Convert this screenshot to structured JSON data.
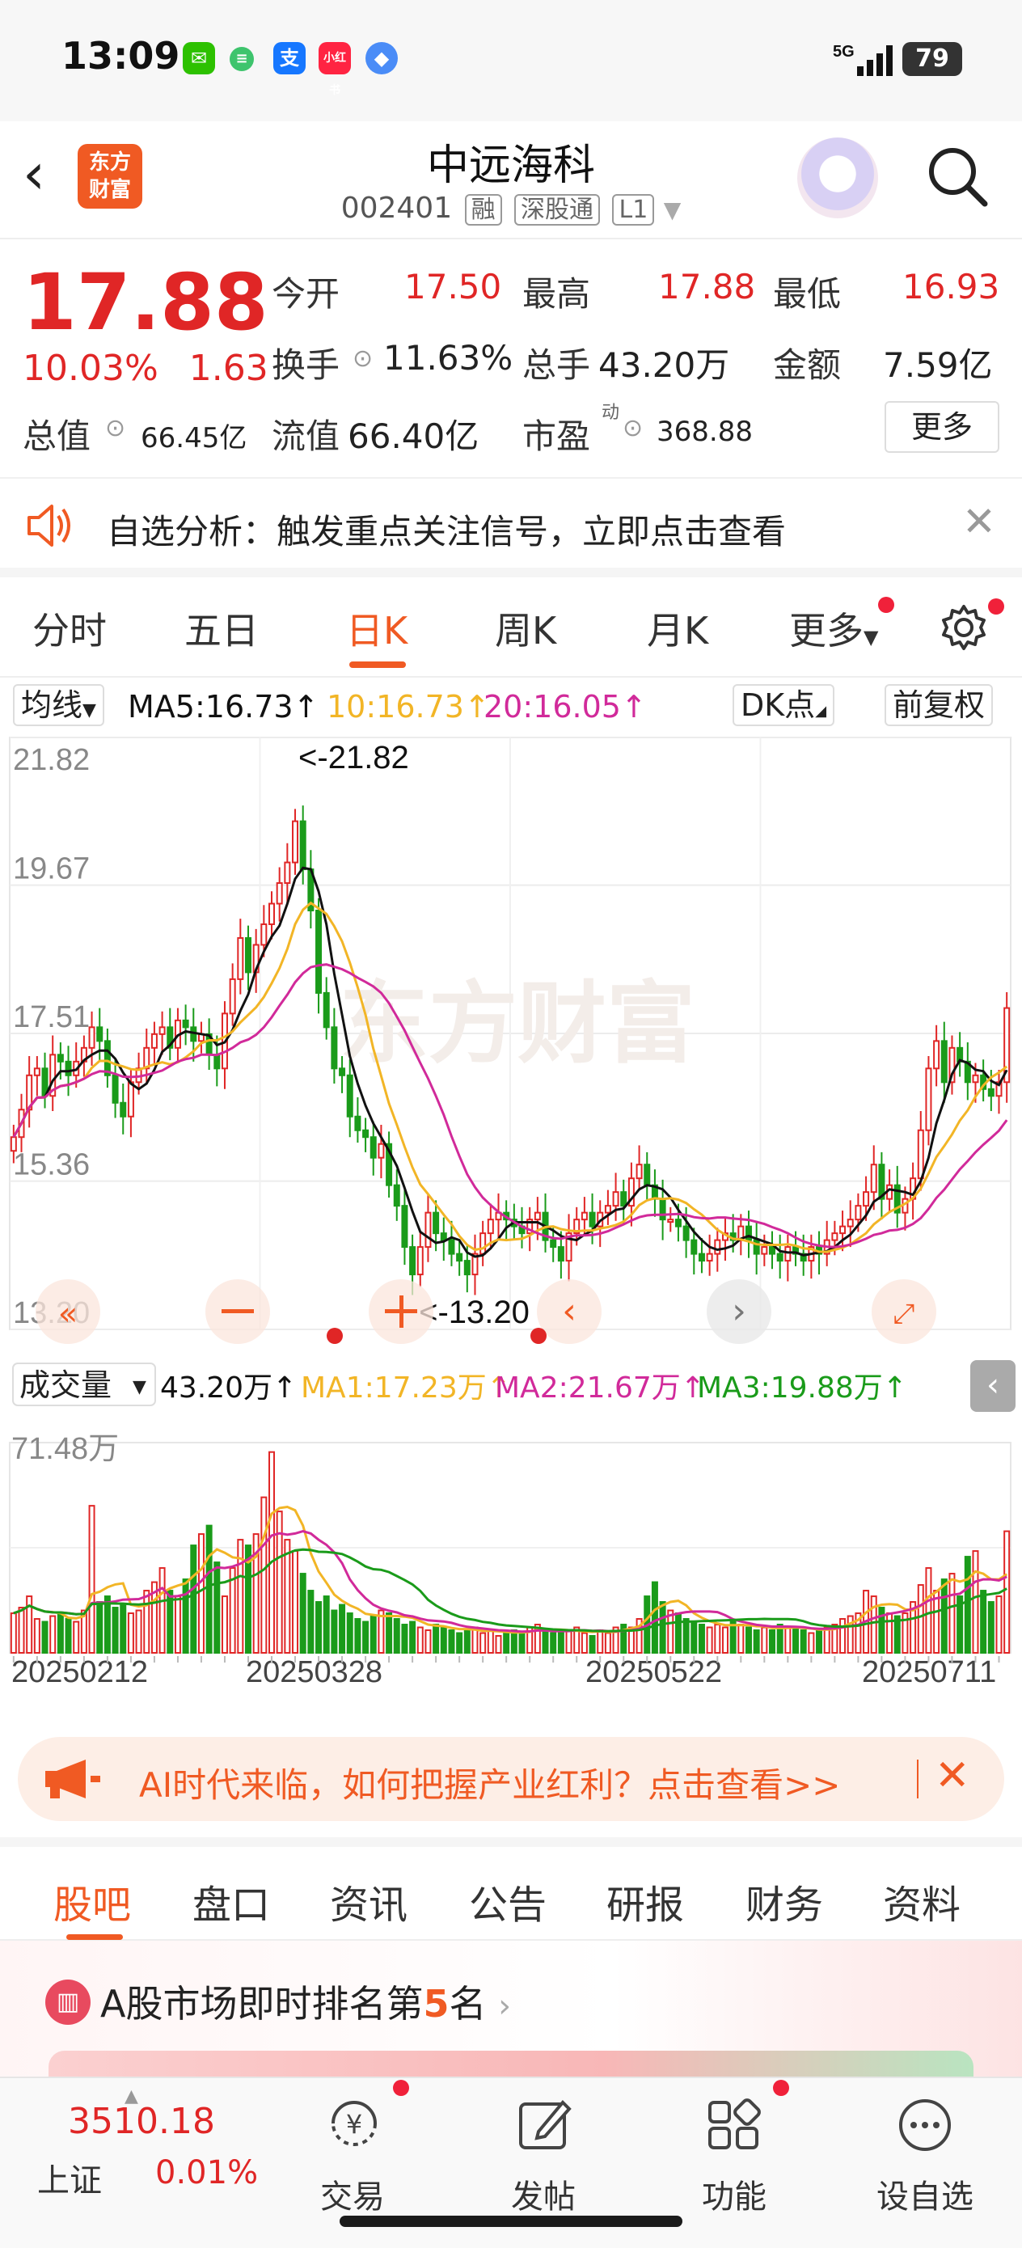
{
  "status_bar": {
    "time": "13:09",
    "network": "5G",
    "battery": "79"
  },
  "header": {
    "stock_name": "中远海科",
    "code": "002401",
    "tags": [
      "融",
      "深股通",
      "L1"
    ],
    "logo_text": "东方财富"
  },
  "quote": {
    "price": "17.88",
    "change_pct": "10.03%",
    "change": "1.63",
    "rows": [
      [
        {
          "label": "今开",
          "value": "17.50",
          "color": "red"
        },
        {
          "label": "最高",
          "value": "17.88",
          "color": "red"
        },
        {
          "label": "最低",
          "value": "16.93",
          "color": "red"
        }
      ],
      [
        {
          "label": "换手",
          "value": "11.63%",
          "color": "blk"
        },
        {
          "label": "总手",
          "value": "43.20万",
          "color": "blk"
        },
        {
          "label": "金额",
          "value": "7.59亿",
          "color": "blk"
        }
      ]
    ],
    "total_value_label": "总值",
    "total_value": "66.45亿",
    "float_value_label": "流值",
    "float_value": "66.40亿",
    "pe_label": "市盈",
    "pe_sup": "动",
    "pe_value": "368.88",
    "more_label": "更多"
  },
  "alert": {
    "text": "自选分析：触发重点关注信号，立即点击查看"
  },
  "tabs": {
    "items": [
      "分时",
      "五日",
      "日K",
      "周K",
      "月K",
      "更多"
    ],
    "active": "日K"
  },
  "indicators": {
    "ma_selector": "均线",
    "ma5": "MA5:16.73↑",
    "ma10": "10:16.73↑",
    "ma20": "20:16.05↑",
    "dk": "DK点",
    "adjust": "前复权",
    "vol_selector": "成交量",
    "vol": "43.20万↑",
    "vma1": "MA1:17.23万↑",
    "vma2": "MA2:21.67万↑",
    "vma3": "MA3:19.88万↑",
    "watermark": "东方财富"
  },
  "colors": {
    "up": "#e02626",
    "down": "#1a9b1a",
    "ma5": "#111111",
    "ma10": "#f2b526",
    "ma20": "#d12a9a",
    "accent": "#f05a23"
  },
  "chart_data": {
    "type": "candlestick",
    "ylim": [
      13.2,
      21.82
    ],
    "y_ticks": [
      "21.82",
      "19.67",
      "17.51",
      "15.36",
      "13.20"
    ],
    "max_label": "<-21.82",
    "min_label": "<-13.20",
    "date_labels": [
      "20250212",
      "20250328",
      "20250522",
      "20250711"
    ],
    "volume_ylim_label": "71.48万",
    "volume_max": 71.48,
    "closes": [
      16.0,
      16.4,
      16.9,
      17.0,
      16.6,
      17.2,
      17.1,
      16.9,
      17.1,
      17.3,
      17.6,
      17.4,
      16.9,
      16.5,
      16.3,
      16.8,
      17.0,
      17.3,
      17.5,
      17.6,
      17.3,
      17.7,
      17.6,
      17.4,
      17.5,
      17.2,
      17.0,
      17.8,
      18.3,
      18.9,
      18.4,
      18.8,
      19.1,
      19.4,
      19.7,
      20.0,
      20.6,
      19.9,
      19.3,
      18.1,
      17.6,
      17.0,
      16.9,
      16.3,
      16.1,
      16.0,
      15.7,
      15.9,
      15.3,
      15.0,
      14.4,
      14.0,
      14.4,
      14.9,
      14.6,
      14.5,
      14.3,
      14.2,
      14.0,
      14.3,
      14.6,
      14.8,
      14.9,
      14.8,
      14.7,
      14.6,
      14.8,
      14.9,
      14.5,
      14.4,
      14.2,
      14.6,
      14.8,
      14.9,
      14.7,
      14.9,
      15.0,
      15.2,
      15.0,
      15.4,
      15.6,
      15.3,
      15.1,
      14.8,
      14.8,
      14.7,
      14.5,
      14.3,
      14.2,
      14.3,
      14.5,
      14.6,
      14.5,
      14.7,
      14.5,
      14.3,
      14.4,
      14.3,
      14.2,
      14.4,
      14.3,
      14.2,
      14.4,
      14.3,
      14.5,
      14.6,
      14.7,
      14.8,
      15.0,
      15.2,
      15.6,
      15.1,
      15.3,
      14.9,
      15.1,
      15.4,
      16.1,
      17.0,
      17.4,
      16.8,
      17.3,
      17.1,
      16.8,
      16.9,
      16.7,
      16.6,
      16.8,
      17.88
    ],
    "volumes": [
      14,
      16,
      20,
      12,
      11,
      13,
      14,
      12,
      11,
      15,
      52,
      18,
      20,
      16,
      17,
      14,
      15,
      22,
      25,
      30,
      22,
      20,
      26,
      38,
      42,
      45,
      32,
      20,
      30,
      40,
      38,
      42,
      55,
      71,
      50,
      40,
      36,
      28,
      22,
      18,
      20,
      15,
      17,
      14,
      12,
      11,
      13,
      15,
      14,
      12,
      10,
      11,
      9,
      8,
      10,
      9,
      8,
      7,
      8,
      9,
      7,
      8,
      6,
      7,
      8,
      7,
      9,
      10,
      8,
      7,
      7,
      8,
      9,
      7,
      6,
      8,
      7,
      9,
      10,
      9,
      12,
      20,
      25,
      18,
      15,
      14,
      12,
      11,
      10,
      9,
      10,
      9,
      11,
      10,
      9,
      8,
      9,
      8,
      10,
      9,
      9,
      8,
      7,
      8,
      9,
      10,
      12,
      13,
      14,
      22,
      20,
      16,
      14,
      13,
      14,
      18,
      24,
      30,
      22,
      26,
      28,
      20,
      34,
      36,
      22,
      18,
      20,
      43
    ]
  },
  "ai_banner": {
    "text": "AI时代来临，如何把握产业红利？点击查看>>"
  },
  "bottom_tabs": {
    "items": [
      "股吧",
      "盘口",
      "资讯",
      "公告",
      "研报",
      "财务",
      "资料"
    ],
    "active": "股吧"
  },
  "rank": {
    "prefix": "A股市场即时排名第",
    "number": "5",
    "suffix": "名"
  },
  "bottom_nav": {
    "index_value": "3510.18",
    "index_name": "上证",
    "index_change": "0.01%",
    "items": [
      "交易",
      "发帖",
      "功能",
      "设自选"
    ]
  }
}
